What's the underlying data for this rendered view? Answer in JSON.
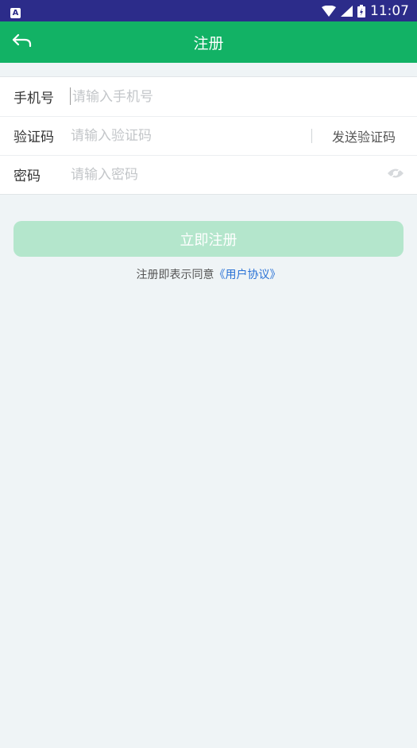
{
  "status_bar": {
    "indicator": "A",
    "time": "11:07",
    "icons": [
      "wifi-icon",
      "signal-icon",
      "battery-icon"
    ]
  },
  "header": {
    "title": "注册",
    "back_icon": "back-arrow-icon"
  },
  "form": {
    "phone": {
      "label": "手机号",
      "placeholder": "请输入手机号",
      "value": ""
    },
    "code": {
      "label": "验证码",
      "placeholder": "请输入验证码",
      "value": "",
      "send_label": "发送验证码"
    },
    "password": {
      "label": "密码",
      "placeholder": "请输入密码",
      "value": "",
      "toggle_icon": "eye-icon"
    }
  },
  "submit": {
    "label": "立即注册"
  },
  "agreement": {
    "text": "注册即表示同意",
    "link": "《用户协议》"
  },
  "colors": {
    "status_bar": "#2c2c8a",
    "header": "#12b265",
    "submit_disabled": "#b4e6cc",
    "link": "#2a72d6",
    "background": "#eff4f6"
  }
}
